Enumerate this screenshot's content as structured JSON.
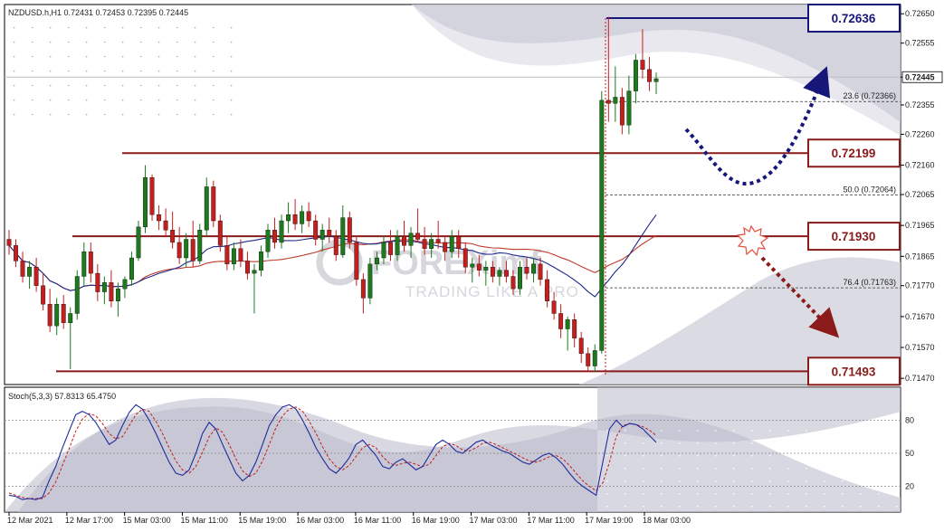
{
  "chart_data": {
    "type": "candlestick",
    "symbol_header": "NZDUSD.h,H1  0.72431 0.72453 0.72395 0.72445",
    "watermark": {
      "brand": "FOREXimf",
      "tagline": "TRADING LIKE A PRO"
    },
    "price_axis": {
      "ylim": [
        0.7145,
        0.7268
      ],
      "ticks": [
        "0.72650",
        "0.72555",
        "0.72445",
        "0.72355",
        "0.72260",
        "0.72160",
        "0.72065",
        "0.71965",
        "0.71865",
        "0.71770",
        "0.71670",
        "0.71570",
        "0.71470"
      ],
      "current_price": "0.72445"
    },
    "time_axis": {
      "labels": [
        "12 Mar 2021",
        "12 Mar 17:00",
        "15 Mar 03:00",
        "15 Mar 11:00",
        "15 Mar 19:00",
        "16 Mar 03:00",
        "16 Mar 11:00",
        "16 Mar 19:00",
        "17 Mar 03:00",
        "17 Mar 11:00",
        "17 Mar 19:00",
        "18 Mar 03:00"
      ]
    },
    "levels": [
      {
        "label": "0.72636",
        "value": 0.72636,
        "color": "#17177a"
      },
      {
        "label": "0.72199",
        "value": 0.72199,
        "color": "#8b1a1a"
      },
      {
        "label": "0.71930",
        "value": 0.7193,
        "color": "#8b1a1a"
      },
      {
        "label": "0.71493",
        "value": 0.71493,
        "color": "#8b1a1a"
      }
    ],
    "fibonacci": [
      {
        "label": "23.6 (0.72366)",
        "value": 0.72366
      },
      {
        "label": "50.0 (0.72064)",
        "value": 0.72064
      },
      {
        "label": "76.4 (0.71763)",
        "value": 0.71763
      }
    ],
    "candles": [
      [
        0.7192,
        0.7195,
        0.7187,
        0.719
      ],
      [
        0.719,
        0.7192,
        0.7183,
        0.7185
      ],
      [
        0.7185,
        0.7188,
        0.7178,
        0.718
      ],
      [
        0.718,
        0.7185,
        0.7176,
        0.7183
      ],
      [
        0.7183,
        0.7186,
        0.7175,
        0.7177
      ],
      [
        0.7177,
        0.7181,
        0.7169,
        0.7171
      ],
      [
        0.7171,
        0.7176,
        0.7162,
        0.7164
      ],
      [
        0.7164,
        0.7173,
        0.7161,
        0.7171
      ],
      [
        0.7171,
        0.7174,
        0.7163,
        0.7165
      ],
      [
        0.7165,
        0.717,
        0.715,
        0.7168
      ],
      [
        0.7168,
        0.7182,
        0.7166,
        0.718
      ],
      [
        0.718,
        0.7191,
        0.7177,
        0.7188
      ],
      [
        0.7188,
        0.7191,
        0.7178,
        0.7181
      ],
      [
        0.7181,
        0.7184,
        0.7172,
        0.7175
      ],
      [
        0.7175,
        0.718,
        0.7171,
        0.7178
      ],
      [
        0.7178,
        0.7182,
        0.717,
        0.7172
      ],
      [
        0.7172,
        0.7178,
        0.7167,
        0.7176
      ],
      [
        0.7176,
        0.718,
        0.7173,
        0.7179
      ],
      [
        0.7179,
        0.7188,
        0.7177,
        0.7186
      ],
      [
        0.7186,
        0.7198,
        0.7185,
        0.7196
      ],
      [
        0.7196,
        0.7216,
        0.7194,
        0.7212
      ],
      [
        0.7212,
        0.7213,
        0.7198,
        0.72
      ],
      [
        0.72,
        0.7203,
        0.7195,
        0.7198
      ],
      [
        0.7198,
        0.7202,
        0.7193,
        0.7195
      ],
      [
        0.7195,
        0.7201,
        0.7189,
        0.7191
      ],
      [
        0.7191,
        0.7196,
        0.7184,
        0.7186
      ],
      [
        0.7186,
        0.7194,
        0.7183,
        0.7192
      ],
      [
        0.7192,
        0.7198,
        0.7183,
        0.7185
      ],
      [
        0.7185,
        0.7197,
        0.7184,
        0.7195
      ],
      [
        0.7195,
        0.7212,
        0.7193,
        0.7209
      ],
      [
        0.7209,
        0.7211,
        0.7196,
        0.7198
      ],
      [
        0.7198,
        0.72,
        0.7188,
        0.719
      ],
      [
        0.719,
        0.7193,
        0.7182,
        0.7184
      ],
      [
        0.7184,
        0.7191,
        0.7182,
        0.7189
      ],
      [
        0.7189,
        0.7192,
        0.7183,
        0.7185
      ],
      [
        0.7185,
        0.7188,
        0.7179,
        0.7181
      ],
      [
        0.7181,
        0.7184,
        0.7168,
        0.7182
      ],
      [
        0.7182,
        0.719,
        0.718,
        0.7188
      ],
      [
        0.7188,
        0.7197,
        0.7186,
        0.7195
      ],
      [
        0.7195,
        0.7199,
        0.7189,
        0.7191
      ],
      [
        0.7191,
        0.72,
        0.7189,
        0.7198
      ],
      [
        0.7198,
        0.7204,
        0.7194,
        0.72
      ],
      [
        0.72,
        0.7205,
        0.7195,
        0.7197
      ],
      [
        0.7197,
        0.7203,
        0.7194,
        0.7201
      ],
      [
        0.7201,
        0.7204,
        0.7196,
        0.7198
      ],
      [
        0.7198,
        0.72,
        0.719,
        0.7192
      ],
      [
        0.7192,
        0.7197,
        0.7188,
        0.7195
      ],
      [
        0.7195,
        0.7199,
        0.7191,
        0.7193
      ],
      [
        0.7193,
        0.7195,
        0.7185,
        0.7187
      ],
      [
        0.7187,
        0.7203,
        0.7186,
        0.7199
      ],
      [
        0.7199,
        0.7201,
        0.7189,
        0.7191
      ],
      [
        0.7191,
        0.7193,
        0.7177,
        0.7179
      ],
      [
        0.7179,
        0.7181,
        0.7168,
        0.7173
      ],
      [
        0.7173,
        0.7186,
        0.7171,
        0.7184
      ],
      [
        0.7184,
        0.7188,
        0.7182,
        0.7186
      ],
      [
        0.7186,
        0.7193,
        0.7184,
        0.7191
      ],
      [
        0.7191,
        0.7195,
        0.7185,
        0.7187
      ],
      [
        0.7187,
        0.7195,
        0.7185,
        0.7193
      ],
      [
        0.7193,
        0.7198,
        0.7188,
        0.719
      ],
      [
        0.719,
        0.7196,
        0.7186,
        0.7194
      ],
      [
        0.7194,
        0.7202,
        0.7191,
        0.7192
      ],
      [
        0.7192,
        0.7196,
        0.7187,
        0.7189
      ],
      [
        0.7189,
        0.7194,
        0.7186,
        0.7192
      ],
      [
        0.7192,
        0.7198,
        0.7189,
        0.7191
      ],
      [
        0.7191,
        0.7193,
        0.7185,
        0.7188
      ],
      [
        0.7188,
        0.7195,
        0.7186,
        0.7193
      ],
      [
        0.7193,
        0.7195,
        0.7186,
        0.7189
      ],
      [
        0.7189,
        0.7191,
        0.7181,
        0.7183
      ],
      [
        0.7183,
        0.7186,
        0.7178,
        0.7184
      ],
      [
        0.7184,
        0.7187,
        0.718,
        0.7182
      ],
      [
        0.7182,
        0.7185,
        0.7177,
        0.7183
      ],
      [
        0.7183,
        0.7185,
        0.7178,
        0.718
      ],
      [
        0.718,
        0.7183,
        0.7177,
        0.7182
      ],
      [
        0.7182,
        0.7185,
        0.7178,
        0.718
      ],
      [
        0.718,
        0.7182,
        0.7174,
        0.7176
      ],
      [
        0.7176,
        0.7185,
        0.7174,
        0.7183
      ],
      [
        0.7183,
        0.7186,
        0.7179,
        0.7181
      ],
      [
        0.7181,
        0.7186,
        0.7178,
        0.7184
      ],
      [
        0.7184,
        0.7186,
        0.7177,
        0.7179
      ],
      [
        0.7179,
        0.7182,
        0.717,
        0.7172
      ],
      [
        0.7172,
        0.7175,
        0.7166,
        0.7168
      ],
      [
        0.7168,
        0.7171,
        0.716,
        0.7163
      ],
      [
        0.7163,
        0.7167,
        0.7156,
        0.7166
      ],
      [
        0.7166,
        0.7168,
        0.7157,
        0.716
      ],
      [
        0.716,
        0.7162,
        0.7152,
        0.7155
      ],
      [
        0.7155,
        0.7157,
        0.7149,
        0.7151
      ],
      [
        0.7151,
        0.7158,
        0.7149,
        0.7156
      ],
      [
        0.7156,
        0.724,
        0.7155,
        0.7237
      ],
      [
        0.7237,
        0.7264,
        0.723,
        0.7236
      ],
      [
        0.7236,
        0.7248,
        0.723,
        0.7238
      ],
      [
        0.7238,
        0.7241,
        0.7226,
        0.7229
      ],
      [
        0.7229,
        0.7245,
        0.7226,
        0.724
      ],
      [
        0.724,
        0.7252,
        0.7236,
        0.725
      ],
      [
        0.725,
        0.726,
        0.7244,
        0.7247
      ],
      [
        0.7247,
        0.7251,
        0.724,
        0.7243
      ],
      [
        0.7243,
        0.7246,
        0.7239,
        0.7244
      ]
    ],
    "stochastic": {
      "title": "Stoch(5,3,3) 57.8313 65.4750",
      "ylim": [
        0,
        100
      ],
      "ticks": [
        "80",
        "50",
        "20"
      ],
      "main": [
        12,
        11,
        8,
        9,
        8,
        10,
        25,
        38,
        55,
        70,
        85,
        88,
        85,
        78,
        68,
        58,
        62,
        75,
        87,
        94,
        90,
        80,
        68,
        55,
        42,
        32,
        30,
        35,
        50,
        68,
        78,
        72,
        58,
        45,
        32,
        25,
        30,
        42,
        58,
        75,
        85,
        92,
        94,
        90,
        80,
        68,
        55,
        45,
        36,
        32,
        38,
        46,
        58,
        62,
        55,
        48,
        38,
        36,
        42,
        45,
        40,
        35,
        38,
        48,
        58,
        62,
        58,
        52,
        50,
        55,
        60,
        62,
        58,
        55,
        52,
        50,
        46,
        42,
        40,
        44,
        48,
        50,
        46,
        40,
        32,
        25,
        20,
        16,
        12,
        42,
        72,
        80,
        74,
        77,
        76,
        72,
        66,
        60
      ],
      "signal": [
        14,
        12,
        10,
        9,
        9,
        9,
        14,
        24,
        39,
        54,
        70,
        81,
        86,
        84,
        77,
        68,
        63,
        65,
        75,
        85,
        90,
        88,
        79,
        68,
        55,
        43,
        35,
        32,
        38,
        51,
        65,
        73,
        69,
        58,
        45,
        34,
        29,
        32,
        43,
        58,
        73,
        84,
        90,
        92,
        88,
        79,
        68,
        56,
        45,
        38,
        35,
        39,
        47,
        55,
        58,
        55,
        47,
        41,
        39,
        41,
        42,
        40,
        38,
        40,
        48,
        56,
        59,
        57,
        53,
        52,
        55,
        59,
        60,
        58,
        55,
        52,
        49,
        46,
        43,
        42,
        44,
        47,
        48,
        45,
        39,
        32,
        25,
        20,
        16,
        23,
        42,
        65,
        75,
        77,
        76,
        74,
        71,
        66
      ]
    },
    "colors": {
      "bull": "#1c7a1c",
      "bear": "#c41e1e",
      "level_blue": "#17177a",
      "level_red": "#8b1a1a",
      "ma_red": "#c0392b",
      "ma_blue": "#1f2a8a"
    }
  }
}
